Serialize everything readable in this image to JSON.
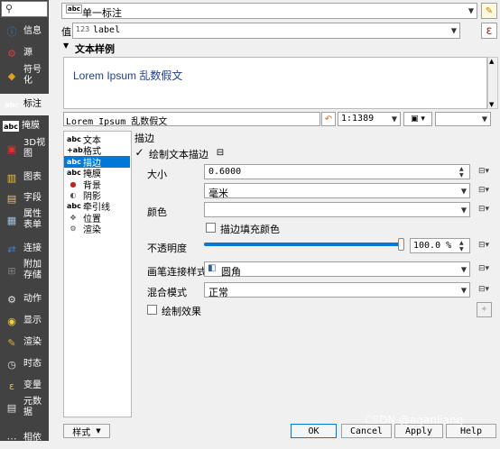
{
  "sidebar": {
    "search_icon": "search-icon",
    "items": [
      {
        "label": "信息",
        "icon": "info-icon",
        "color": "#3d7fc1"
      },
      {
        "label": "源",
        "icon": "source-icon",
        "color": "#d04040"
      },
      {
        "label": "符号\n化",
        "icon": "symbology-icon",
        "color": "#e0a020"
      },
      {
        "label": "标注",
        "icon": "labels-icon",
        "color": "#ffffff"
      },
      {
        "label": "掩膜",
        "icon": "mask-icon",
        "color": "#ffffff"
      },
      {
        "label": "3D视\n图",
        "icon": "3d-view-icon",
        "color": "#e03030"
      },
      {
        "label": "图表",
        "icon": "diagram-icon",
        "color": "#f0c030"
      },
      {
        "label": "字段",
        "icon": "fields-icon",
        "color": "#e0c080"
      },
      {
        "label": "属性\n表单",
        "icon": "attributes-form-icon",
        "color": "#a0c0e0"
      },
      {
        "label": "连接",
        "icon": "joins-icon",
        "color": "#4080d0"
      },
      {
        "label": "附加\n存储",
        "icon": "aux-storage-icon",
        "color": "#808080"
      },
      {
        "label": "动作",
        "icon": "actions-icon",
        "color": "#e0e0e0"
      },
      {
        "label": "显示",
        "icon": "display-icon",
        "color": "#f0d040"
      },
      {
        "label": "渲染",
        "icon": "rendering-icon",
        "color": "#e0b040"
      },
      {
        "label": "时态",
        "icon": "temporal-icon",
        "color": "#e0e0e0"
      },
      {
        "label": "变量",
        "icon": "variables-icon",
        "color": "#e0c060"
      },
      {
        "label": "元数\n据",
        "icon": "metadata-icon",
        "color": "#e0e0e0"
      },
      {
        "label": "相依",
        "icon": "dependencies-icon",
        "color": "#e0e0e0"
      }
    ]
  },
  "header": {
    "mode_badge": "abc",
    "mode_value": "单一标注",
    "value_label": "值",
    "value_type_badge": "123",
    "value_field": "label",
    "epsilon": "ε"
  },
  "sample": {
    "section_title": "文本样例",
    "preview_text": "Lorem Ipsum 乱数假文",
    "preview_color": "#1f3f8f",
    "input_text": "Lorem Ipsum 乱数假文",
    "scale": "1:1389"
  },
  "tree": {
    "items": [
      {
        "badge": "abc",
        "label": "文本"
      },
      {
        "badge": "+ab",
        "label": "格式"
      },
      {
        "badge": "abc",
        "label": "描边"
      },
      {
        "badge": "abc",
        "label": "掩膜"
      },
      {
        "badge": "",
        "label": "背景"
      },
      {
        "badge": "",
        "label": "阴影"
      },
      {
        "badge": "abc",
        "label": "牵引线"
      },
      {
        "badge": "",
        "label": "位置"
      },
      {
        "badge": "",
        "label": "渲染"
      }
    ]
  },
  "buffer": {
    "title": "描边",
    "draw_buffer_label": "绘制文本描边",
    "draw_buffer_checked": true,
    "size_label": "大小",
    "size_value": "0.6000",
    "unit_value": "毫米",
    "color_label": "颜色",
    "color_value": "#ffffff",
    "fill_label": "描边填充颜色",
    "opacity_label": "不透明度",
    "opacity_value": "100.0 %",
    "opacity_fraction": 1.0,
    "pen_join_label": "画笔连接样式",
    "pen_join_value": "圆角",
    "blend_label": "混合模式",
    "blend_value": "正常",
    "effects_label": "绘制效果"
  },
  "footer": {
    "style_label": "样式",
    "ok_label": "OK",
    "cancel_label": "Cancel",
    "apply_label": "Apply",
    "help_label": "Help",
    "watermark": "CSDN @aganliang"
  }
}
